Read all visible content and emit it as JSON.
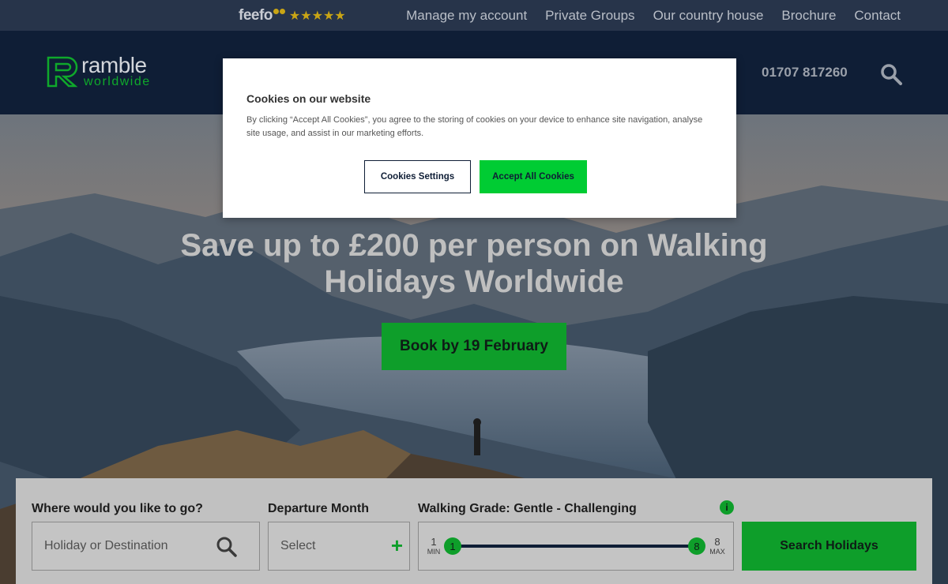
{
  "topbar": {
    "feefo_brand": "feefo",
    "stars": "★★★★★",
    "links": [
      "Manage my account",
      "Private Groups",
      "Our country house",
      "Brochure",
      "Contact"
    ]
  },
  "header": {
    "logo_line1": "ramble",
    "logo_line2": "worldwide",
    "phone": "01707 817260",
    "search_icon": "search-icon"
  },
  "hero": {
    "title": "Save up to £200 per person on Walking Holidays Worldwide",
    "cta": "Book by 19 February"
  },
  "search_panel": {
    "destination_label": "Where would you like to go?",
    "destination_placeholder": "Holiday or Destination",
    "month_label": "Departure Month",
    "month_value": "Select",
    "grade_label": "Walking Grade: Gentle - Challenging",
    "info_icon": "i",
    "min_value": "1",
    "min_label": "MIN",
    "max_value": "8",
    "max_label": "MAX",
    "handle_low": "1",
    "handle_high": "8",
    "search_button": "Search Holidays"
  },
  "cookie_modal": {
    "title": "Cookies on our website",
    "text": "By clicking “Accept All Cookies”, you agree to the storing of cookies on your device to enhance site navigation, analyse site usage, and assist in our marketing efforts.",
    "settings_button": "Cookies Settings",
    "accept_button": "Accept All Cookies"
  },
  "colors": {
    "brand_green": "#0e9e2a",
    "accept_green": "#00cc33",
    "navy": "#0f1e36"
  }
}
